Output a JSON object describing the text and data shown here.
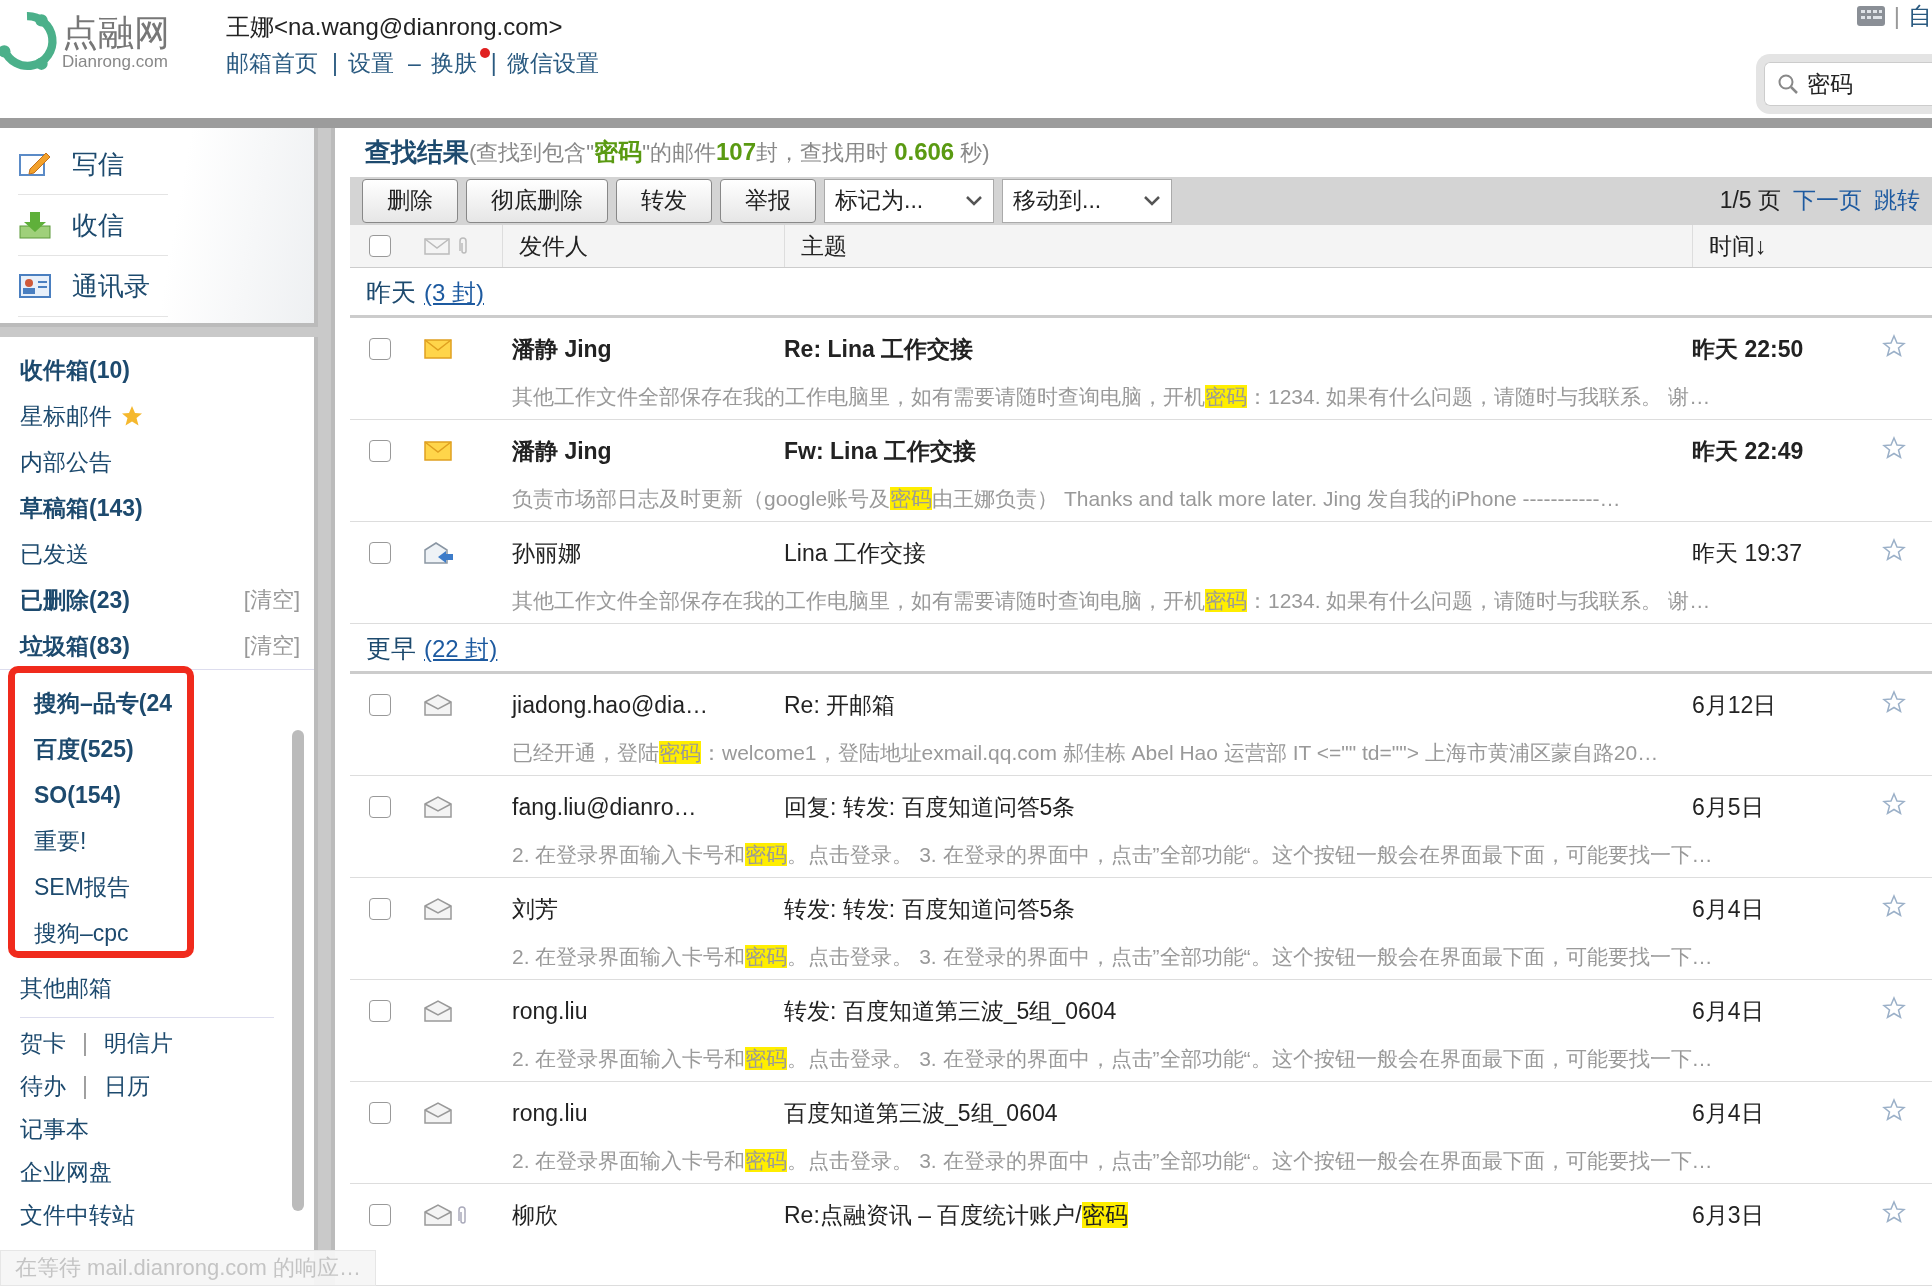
{
  "header": {
    "logo": {
      "name": "点融网",
      "domain": "Dianrong.com"
    },
    "user": "王娜<na.wang@dianrong.com>",
    "links": [
      {
        "label": "邮箱首页"
      },
      {
        "label": "设置"
      },
      {
        "label": "换肤",
        "badge": true
      },
      {
        "label": "微信设置"
      }
    ],
    "link_separators": [
      "|",
      "–",
      "|"
    ],
    "top_right": {
      "separator": "|",
      "label": "自"
    },
    "search": {
      "value": "密码"
    }
  },
  "sidebar": {
    "actions": [
      {
        "label": "写信",
        "kind": "compose"
      },
      {
        "label": "收信",
        "kind": "receive"
      },
      {
        "label": "通讯录",
        "kind": "contacts"
      }
    ],
    "folders": [
      {
        "label": "收件箱(10)",
        "has_unread": true
      },
      {
        "label": "星标邮件",
        "has_unread": false,
        "starred": true
      },
      {
        "label": "内部公告",
        "has_unread": false
      },
      {
        "label": "草稿箱(143)",
        "has_unread": true
      },
      {
        "label": "已发送",
        "has_unread": false
      },
      {
        "label": "已删除(23)",
        "has_unread": true,
        "action": "[清空]"
      },
      {
        "label": "垃圾箱(83)",
        "has_unread": true,
        "action": "[清空]"
      }
    ],
    "custom_folders": {
      "highlighted": true,
      "items": [
        {
          "label": "搜狗–品专(24",
          "has_unread": true
        },
        {
          "label": "百度(525)",
          "has_unread": true
        },
        {
          "label": "SO(154)",
          "has_unread": true
        },
        {
          "label": "重要!",
          "has_unread": false
        },
        {
          "label": "SEM报告",
          "has_unread": false
        },
        {
          "label": "搜狗–cpc",
          "has_unread": false
        }
      ]
    },
    "other": "其他邮箱",
    "tools": [
      [
        "贺卡",
        "明信片"
      ],
      [
        "待办",
        "日历"
      ],
      [
        "记事本"
      ],
      [
        "企业网盘"
      ],
      [
        "文件中转站"
      ]
    ],
    "tool_separator": "|"
  },
  "results": {
    "title": "查找结果",
    "summary": "(查找到包含\"**密码**\"的邮件**107**封，查找用时 **0.606** 秒)",
    "toolbar": {
      "buttons": [
        "删除",
        "彻底删除",
        "转发",
        "举报"
      ],
      "dropdowns": [
        "标记为...",
        "移动到..."
      ],
      "page": "1/5 页",
      "next": "下一页",
      "jump": "跳转"
    },
    "columns": {
      "select_all_checked": false,
      "sender": "发件人",
      "subject": "主题",
      "time": "时间↓"
    },
    "groups": [
      {
        "label": "昨天",
        "count": "(3 封)",
        "emails": [
          {
            "sender": "潘静 Jing",
            "subject": [
              {
                "text": "Re: Lina 工作交接",
                "hl": false
              }
            ],
            "time": "昨天 22:50",
            "unread": true,
            "kind": "unread",
            "checked": false,
            "attachment": false,
            "snippet": [
              {
                "text": "其他工作文件全部保存在我的工作电脑里，如有需要请随时查询电脑，开机",
                "hl": false
              },
              {
                "text": "密码",
                "hl": true
              },
              {
                "text": "：1234. 如果有什么问题，请随时与我联系。 谢…",
                "hl": false
              }
            ]
          },
          {
            "sender": "潘静 Jing",
            "subject": [
              {
                "text": "Fw: Lina 工作交接",
                "hl": false
              }
            ],
            "time": "昨天 22:49",
            "unread": true,
            "kind": "unread",
            "checked": false,
            "attachment": false,
            "snippet": [
              {
                "text": "负责市场部日志及时更新（google账号及",
                "hl": false
              },
              {
                "text": "密码",
                "hl": true
              },
              {
                "text": "由王娜负责） Thanks and talk more later. Jing 发自我的iPhone -----------…",
                "hl": false
              }
            ]
          },
          {
            "sender": "孙丽娜",
            "subject": [
              {
                "text": "Lina 工作交接",
                "hl": false
              }
            ],
            "time": "昨天 19:37",
            "unread": false,
            "kind": "replied",
            "checked": false,
            "attachment": false,
            "snippet": [
              {
                "text": "其他工作文件全部保存在我的工作电脑里，如有需要请随时查询电脑，开机",
                "hl": false
              },
              {
                "text": "密码",
                "hl": true
              },
              {
                "text": "：1234. 如果有什么问题，请随时与我联系。 谢…",
                "hl": false
              }
            ]
          }
        ]
      },
      {
        "label": "更早",
        "count": "(22 封)",
        "emails": [
          {
            "sender": "jiadong.hao@dia…",
            "subject": [
              {
                "text": "Re: 开邮箱",
                "hl": false
              }
            ],
            "time": "6月12日",
            "unread": false,
            "kind": "read",
            "checked": false,
            "attachment": false,
            "snippet": [
              {
                "text": "已经开通，登陆",
                "hl": false
              },
              {
                "text": "密码",
                "hl": true
              },
              {
                "text": "：welcome1，登陆地址exmail.qq.com 郝佳栋 Abel Hao 运营部 IT <=\"\" td=\"\"> 上海市黄浦区蒙自路20…",
                "hl": false
              }
            ]
          },
          {
            "sender": "fang.liu@dianro…",
            "subject": [
              {
                "text": "回复: 转发: 百度知道问答5条",
                "hl": false
              }
            ],
            "time": "6月5日",
            "unread": false,
            "kind": "read",
            "checked": false,
            "attachment": false,
            "snippet": [
              {
                "text": "2. 在登录界面输入卡号和",
                "hl": false
              },
              {
                "text": "密码",
                "hl": true
              },
              {
                "text": "。点击登录。 3. 在登录的界面中，点击”全部功能“。这个按钮一般会在界面最下面，可能要找一下…",
                "hl": false
              }
            ]
          },
          {
            "sender": "刘芳",
            "subject": [
              {
                "text": "转发: 转发: 百度知道问答5条",
                "hl": false
              }
            ],
            "time": "6月4日",
            "unread": false,
            "kind": "read",
            "checked": false,
            "attachment": false,
            "snippet": [
              {
                "text": "2. 在登录界面输入卡号和",
                "hl": false
              },
              {
                "text": "密码",
                "hl": true
              },
              {
                "text": "。点击登录。 3. 在登录的界面中，点击”全部功能“。这个按钮一般会在界面最下面，可能要找一下…",
                "hl": false
              }
            ]
          },
          {
            "sender": "rong.liu",
            "subject": [
              {
                "text": "转发: 百度知道第三波_5组_0604",
                "hl": false
              }
            ],
            "time": "6月4日",
            "unread": false,
            "kind": "read",
            "checked": false,
            "attachment": false,
            "snippet": [
              {
                "text": "2. 在登录界面输入卡号和",
                "hl": false
              },
              {
                "text": "密码",
                "hl": true
              },
              {
                "text": "。点击登录。 3. 在登录的界面中，点击”全部功能“。这个按钮一般会在界面最下面，可能要找一下…",
                "hl": false
              }
            ]
          },
          {
            "sender": "rong.liu",
            "subject": [
              {
                "text": "百度知道第三波_5组_0604",
                "hl": false
              }
            ],
            "time": "6月4日",
            "unread": false,
            "kind": "read",
            "checked": false,
            "attachment": false,
            "snippet": [
              {
                "text": "2. 在登录界面输入卡号和",
                "hl": false
              },
              {
                "text": "密码",
                "hl": true
              },
              {
                "text": "。点击登录。 3. 在登录的界面中，点击”全部功能“。这个按钮一般会在界面最下面，可能要找一下…",
                "hl": false
              }
            ]
          },
          {
            "sender": "柳欣",
            "subject": [
              {
                "text": "Re:点融资讯 – 百度统计账户/",
                "hl": false
              },
              {
                "text": "密码",
                "hl": true
              }
            ],
            "time": "6月3日",
            "unread": false,
            "kind": "read",
            "checked": false,
            "attachment": true
          }
        ]
      }
    ]
  },
  "status_bar": "在等待 mail.dianrong.com 的响应…"
}
